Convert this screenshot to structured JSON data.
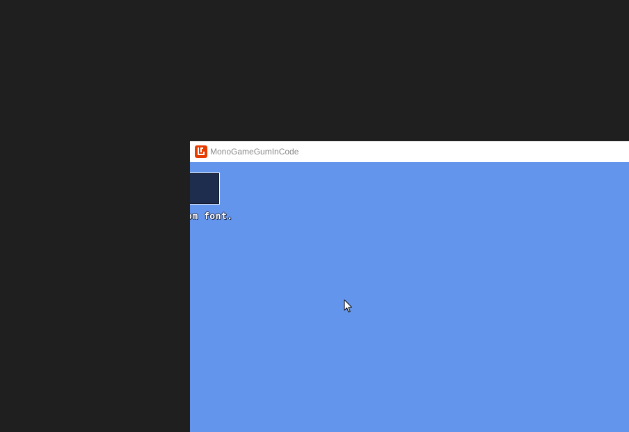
{
  "window": {
    "title": "MonoGameGumInCode",
    "icon": "monogame-logo-icon",
    "icon_color": "#e73c00",
    "background_color": "#6495ed"
  },
  "desktop": {
    "background_color": "#1f1f1f"
  },
  "game": {
    "button": {
      "label": "",
      "fill_color": "#1e2c4d",
      "border_color": "#ffffff"
    },
    "text_label": "om font."
  },
  "cursor": {
    "icon": "arrow-pointer-icon"
  }
}
